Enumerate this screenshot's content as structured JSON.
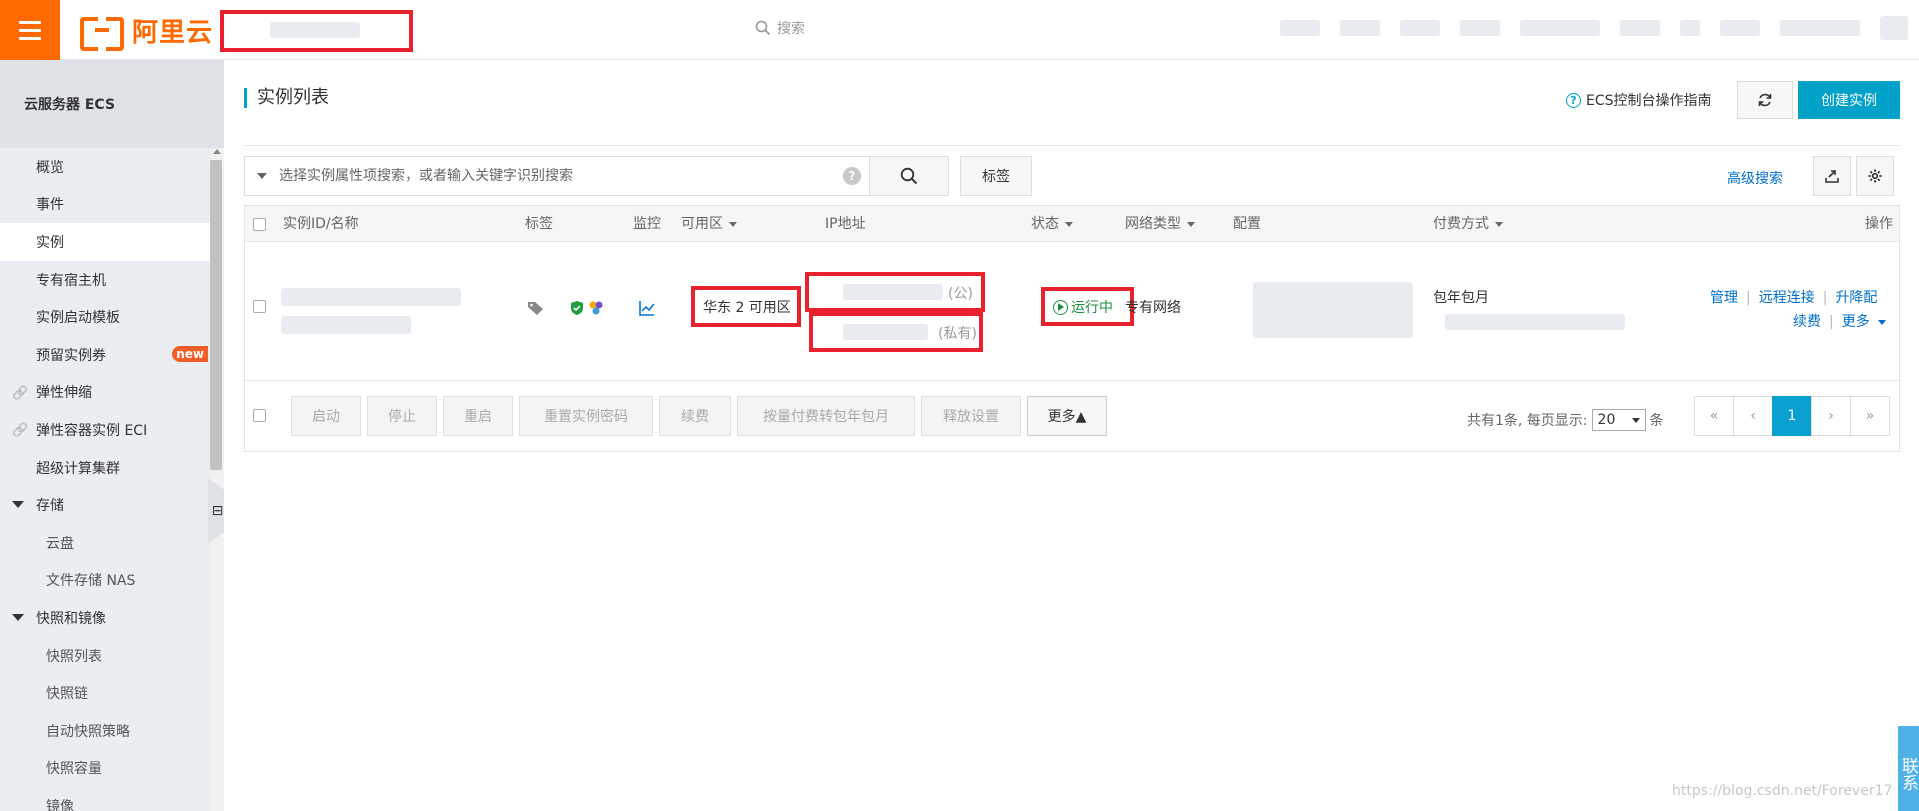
{
  "brand": {
    "logo_text": "阿里云",
    "accent": "#ff6a00"
  },
  "topbar": {
    "search_label": "搜索"
  },
  "sidebar": {
    "title": "云服务器 ECS",
    "items": [
      {
        "label": "概览",
        "type": "item"
      },
      {
        "label": "事件",
        "type": "item"
      },
      {
        "label": "实例",
        "type": "item",
        "active": true
      },
      {
        "label": "专有宿主机",
        "type": "item"
      },
      {
        "label": "实例启动模板",
        "type": "item"
      },
      {
        "label": "预留实例券",
        "type": "item",
        "badge": "new"
      },
      {
        "label": "弹性伸缩",
        "type": "link"
      },
      {
        "label": "弹性容器实例 ECI",
        "type": "link"
      },
      {
        "label": "超级计算集群",
        "type": "item"
      },
      {
        "label": "存储",
        "type": "group"
      },
      {
        "label": "云盘",
        "type": "sub"
      },
      {
        "label": "文件存储 NAS",
        "type": "sub"
      },
      {
        "label": "快照和镜像",
        "type": "group"
      },
      {
        "label": "快照列表",
        "type": "sub"
      },
      {
        "label": "快照链",
        "type": "sub"
      },
      {
        "label": "自动快照策略",
        "type": "sub"
      },
      {
        "label": "快照容量",
        "type": "sub"
      },
      {
        "label": "镜像",
        "type": "sub"
      }
    ]
  },
  "main": {
    "title": "实例列表",
    "guide_label": "ECS控制台操作指南",
    "create_label": "创建实例",
    "search_placeholder": "选择实例属性项搜索，或者输入关键字识别搜索",
    "tag_label": "标签",
    "advanced_search_label": "高级搜索"
  },
  "table": {
    "headers": {
      "id_name": "实例ID/名称",
      "tags": "标签",
      "monitor": "监控",
      "zone": "可用区",
      "ip": "IP地址",
      "status": "状态",
      "network": "网络类型",
      "config": "配置",
      "billing": "付费方式",
      "actions": "操作"
    },
    "row": {
      "zone": "华东 2 可用区",
      "ip_public_suffix": "(公)",
      "ip_private_suffix": "(私有)",
      "status": "运行中",
      "network": "专有网络",
      "billing": "包年包月",
      "actions": {
        "manage": "管理",
        "remote": "远程连接",
        "upgrade": "升降配",
        "renew": "续费",
        "more": "更多"
      }
    },
    "footer_buttons": [
      "启动",
      "停止",
      "重启",
      "重置实例密码",
      "续费",
      "按量付费转包年包月",
      "释放设置",
      "更多▲"
    ],
    "pager": {
      "total_prefix": "共有1条, 每页显示:",
      "page_size": "20",
      "total_suffix": "条",
      "first": "«",
      "prev": "‹",
      "current": "1",
      "next": "›",
      "last": "»"
    }
  },
  "watermark": "https://blog.csdn.net/Forever17",
  "contact_label": "联系"
}
